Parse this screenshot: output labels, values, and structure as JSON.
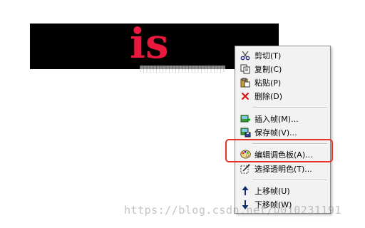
{
  "canvas": {
    "word": "is",
    "word_color": "#e8193c",
    "background": "#000000"
  },
  "menu": {
    "items": [
      {
        "label": "剪切(T)",
        "icon": "scissors-icon"
      },
      {
        "label": "复制(C)",
        "icon": "copy-icon"
      },
      {
        "label": "粘贴(P)",
        "icon": "paste-icon"
      },
      {
        "label": "删除(D)",
        "icon": "delete-x-icon"
      },
      {
        "label": "插入帧(M)...",
        "icon": "insert-frame-icon"
      },
      {
        "label": "保存帧(V)...",
        "icon": "save-frame-icon"
      },
      {
        "label": "编辑调色板(A)...",
        "icon": "palette-icon"
      },
      {
        "label": "选择透明色(T)...",
        "icon": "transparent-color-icon"
      },
      {
        "label": "上移帧(U)",
        "icon": "arrow-up-icon"
      },
      {
        "label": "下移帧(W)",
        "icon": "arrow-down-icon"
      }
    ],
    "highlight_color": "#e8332b"
  },
  "watermark": "https://blog.csdn.net/u010231191"
}
